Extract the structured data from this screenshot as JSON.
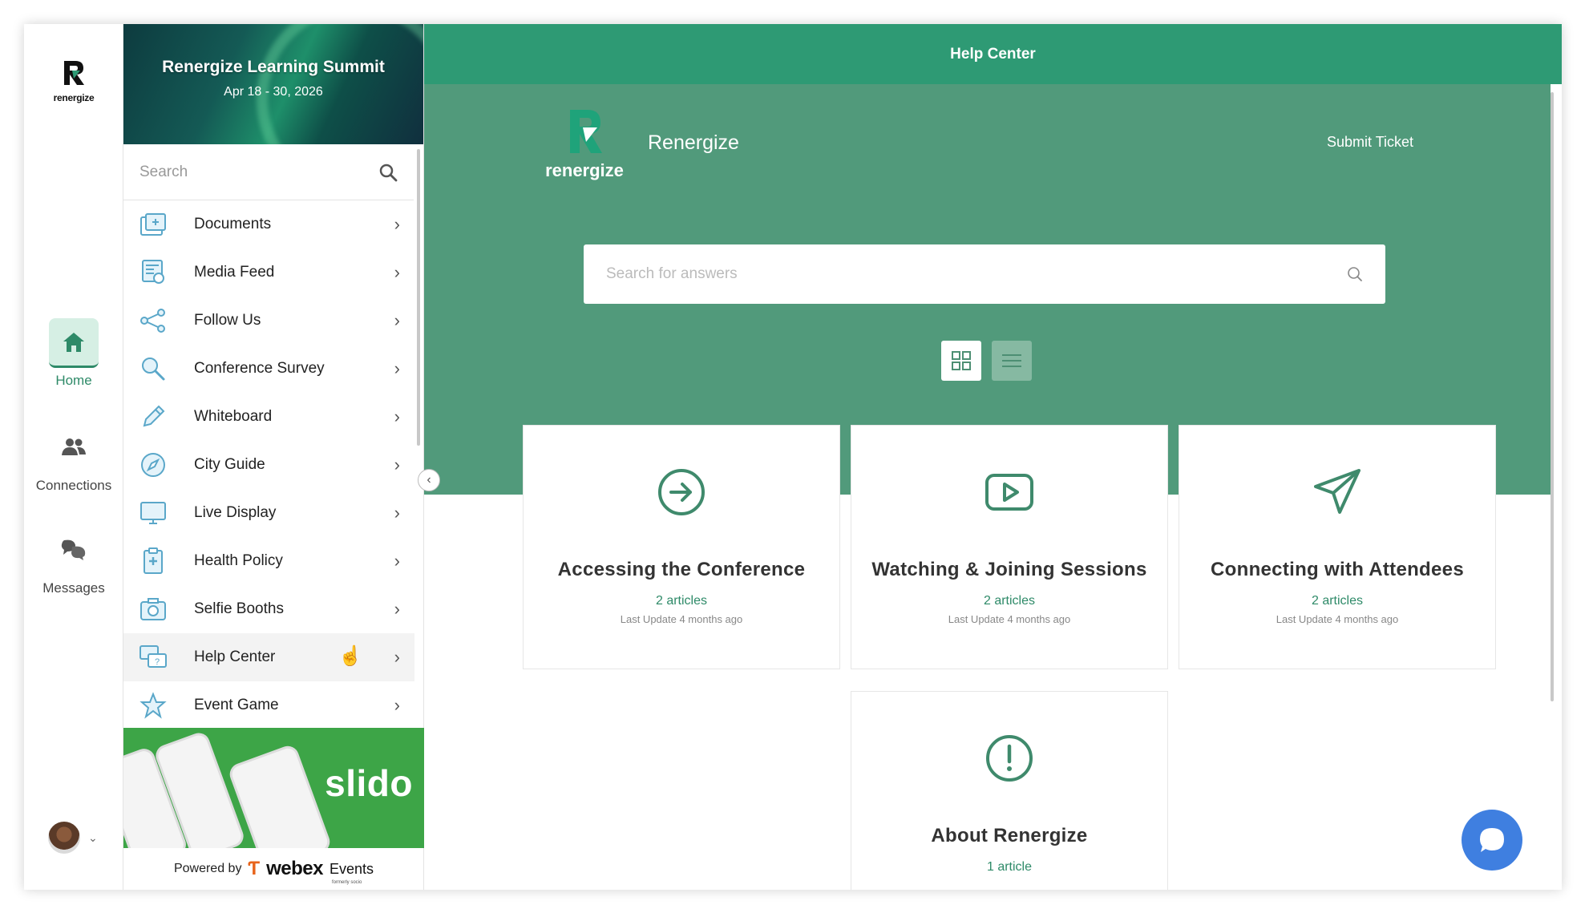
{
  "rail": {
    "logo_text": "renergize",
    "items": [
      {
        "label": "Home",
        "icon": "home-icon",
        "active": true
      },
      {
        "label": "Connections",
        "icon": "people-icon",
        "active": false
      },
      {
        "label": "Messages",
        "icon": "chat-bubbles-icon",
        "active": false
      }
    ]
  },
  "sidebar": {
    "banner_title": "Renergize Learning Summit",
    "banner_date": "Apr 18 - 30, 2026",
    "search_placeholder": "Search",
    "items": [
      {
        "label": "Documents",
        "icon": "documents-icon"
      },
      {
        "label": "Media Feed",
        "icon": "news-icon"
      },
      {
        "label": "Follow Us",
        "icon": "share-icon"
      },
      {
        "label": "Conference Survey",
        "icon": "magnifier-icon"
      },
      {
        "label": "Whiteboard",
        "icon": "pencil-icon"
      },
      {
        "label": "City Guide",
        "icon": "compass-icon"
      },
      {
        "label": "Live Display",
        "icon": "monitor-icon"
      },
      {
        "label": "Health Policy",
        "icon": "clipboard-icon"
      },
      {
        "label": "Selfie Booths",
        "icon": "camera-icon"
      },
      {
        "label": "Help Center",
        "icon": "help-chat-icon"
      },
      {
        "label": "Event Game",
        "icon": "star-icon"
      }
    ],
    "ad_text": "slido",
    "powered_by": "Powered by",
    "powered_brand": "webex",
    "powered_brand_suffix": "Events",
    "powered_formerly": "formerly socio"
  },
  "main": {
    "topbar_title": "Help Center",
    "logo_text": "renergize",
    "brand_name": "Renergize",
    "submit_ticket": "Submit Ticket",
    "search_placeholder": "Search for answers",
    "cards": [
      {
        "title": "Accessing the Conference",
        "articles": "2 articles",
        "updated": "Last Update 4 months ago",
        "icon": "arrow-circle-icon"
      },
      {
        "title": "Watching & Joining Sessions",
        "articles": "2 articles",
        "updated": "Last Update 4 months ago",
        "icon": "play-video-icon"
      },
      {
        "title": "Connecting with Attendees",
        "articles": "2 articles",
        "updated": "Last Update 4 months ago",
        "icon": "paper-plane-icon"
      },
      {
        "title": "About Renergize",
        "articles": "1 article",
        "updated": "",
        "icon": "exclamation-circle-icon"
      }
    ]
  },
  "colors": {
    "brand_green": "#2e9a74",
    "hero_green": "#519a7b",
    "chat_blue": "#3f7fe0"
  }
}
